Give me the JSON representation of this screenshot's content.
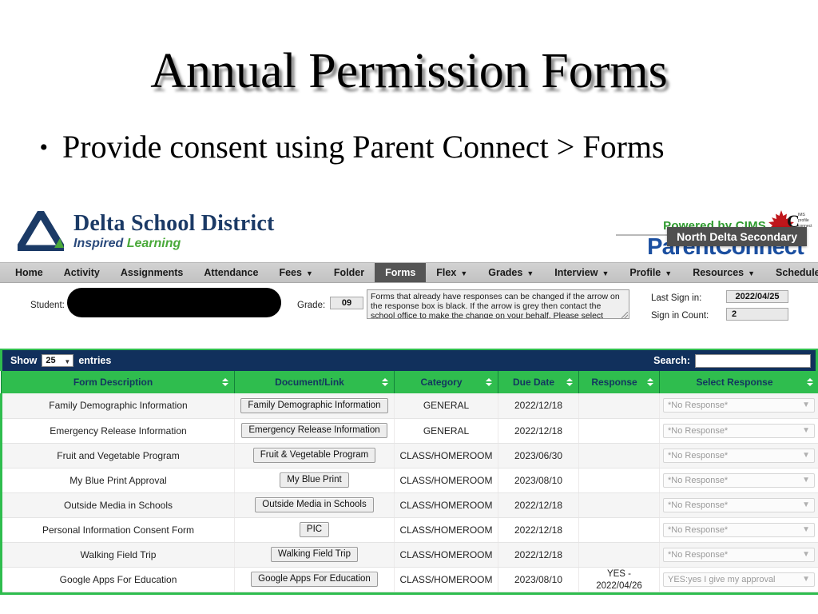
{
  "slide": {
    "title": "Annual Permission Forms",
    "bullet_marker": "•",
    "bullet_text": "Provide consent using Parent Connect > Forms"
  },
  "brand": {
    "district_name": "Delta School District",
    "tagline_italic": "Inspired",
    "tagline_green": "Learning",
    "powered_by": "Powered by CIMS",
    "product_name": "ParentConnect",
    "cims_mark_letter": "C",
    "cims_mark_lines": "IMS\nprofile\nconnect",
    "tooltip": "North Delta Secondary"
  },
  "nav": {
    "items": [
      {
        "label": "Home",
        "has_dropdown": false,
        "active": false
      },
      {
        "label": "Activity",
        "has_dropdown": false,
        "active": false
      },
      {
        "label": "Assignments",
        "has_dropdown": false,
        "active": false
      },
      {
        "label": "Attendance",
        "has_dropdown": false,
        "active": false
      },
      {
        "label": "Fees",
        "has_dropdown": true,
        "active": false
      },
      {
        "label": "Folder",
        "has_dropdown": false,
        "active": false
      },
      {
        "label": "Forms",
        "has_dropdown": false,
        "active": true
      },
      {
        "label": "Flex",
        "has_dropdown": true,
        "active": false
      },
      {
        "label": "Grades",
        "has_dropdown": true,
        "active": false
      },
      {
        "label": "Interview",
        "has_dropdown": true,
        "active": false
      },
      {
        "label": "Profile",
        "has_dropdown": true,
        "active": false
      },
      {
        "label": "Resources",
        "has_dropdown": true,
        "active": false
      },
      {
        "label": "Schedule",
        "has_dropdown": false,
        "active": false
      }
    ]
  },
  "student_strip": {
    "student_label": "Student:",
    "student_value": "",
    "grade_label": "Grade:",
    "grade_value": "09",
    "note_text": "Forms that already have responses can be changed if the arrow on the response box is black. If the arrow is grey then contact the school office to make the change on your behalf. Please select",
    "last_signin_label": "Last Sign in:",
    "last_signin_value": "2022/04/25",
    "signin_count_label": "Sign in Count:",
    "signin_count_value": "2"
  },
  "table_toolbar": {
    "show_label": "Show",
    "entries_value": "25",
    "entries_label": "entries",
    "search_label": "Search:",
    "search_value": "",
    "search_placeholder": ""
  },
  "table": {
    "columns": [
      "Form Description",
      "Document/Link",
      "Category",
      "Due Date",
      "Response",
      "Select Response"
    ],
    "rows": [
      {
        "form_description": "Family Demographic Information",
        "document_link": "Family Demographic Information",
        "category": "GENERAL",
        "due_date": "2022/12/18",
        "response": "",
        "select_response": "*No Response*"
      },
      {
        "form_description": "Emergency Release Information",
        "document_link": "Emergency Release Information",
        "category": "GENERAL",
        "due_date": "2022/12/18",
        "response": "",
        "select_response": "*No Response*"
      },
      {
        "form_description": "Fruit and Vegetable Program",
        "document_link": "Fruit & Vegetable Program",
        "category": "CLASS/HOMEROOM",
        "due_date": "2023/06/30",
        "response": "",
        "select_response": "*No Response*"
      },
      {
        "form_description": "My Blue Print Approval",
        "document_link": "My Blue Print",
        "category": "CLASS/HOMEROOM",
        "due_date": "2023/08/10",
        "response": "",
        "select_response": "*No Response*"
      },
      {
        "form_description": "Outside Media in Schools",
        "document_link": "Outside Media in Schools",
        "category": "CLASS/HOMEROOM",
        "due_date": "2022/12/18",
        "response": "",
        "select_response": "*No Response*"
      },
      {
        "form_description": "Personal Information Consent Form",
        "document_link": "PIC",
        "category": "CLASS/HOMEROOM",
        "due_date": "2022/12/18",
        "response": "",
        "select_response": "*No Response*"
      },
      {
        "form_description": "Walking Field Trip",
        "document_link": "Walking Field Trip",
        "category": "CLASS/HOMEROOM",
        "due_date": "2022/12/18",
        "response": "",
        "select_response": "*No Response*"
      },
      {
        "form_description": "Google Apps For Education",
        "document_link": "Google Apps For Education",
        "category": "CLASS/HOMEROOM",
        "due_date": "2023/08/10",
        "response": "YES - 2022/04/26",
        "select_response": "YES:yes I give my approval"
      }
    ]
  },
  "colors": {
    "header_green": "#2fbd4e",
    "toolbar_navy": "#11305c",
    "brand_navy": "#1b3a66",
    "brand_green": "#4aa93a",
    "parentconnect_blue": "#1b4fa0",
    "powered_green": "#2e9a2e",
    "tooltip_gray": "#4f4f4f",
    "nav_active": "#555555"
  }
}
